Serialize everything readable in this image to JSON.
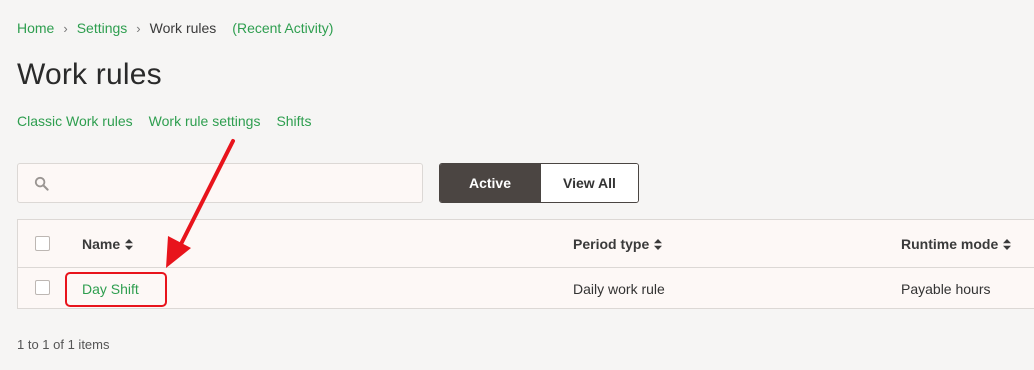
{
  "breadcrumb": {
    "home": "Home",
    "settings": "Settings",
    "current": "Work rules",
    "recent_activity": "(Recent Activity)",
    "separator": "›"
  },
  "page_title": "Work rules",
  "subnav": {
    "classic": "Classic Work rules",
    "settings": "Work rule settings",
    "shifts": "Shifts"
  },
  "search": {
    "value": "",
    "placeholder": ""
  },
  "filter_toggle": {
    "active_label": "Active",
    "view_all_label": "View All",
    "selected": "Active"
  },
  "table": {
    "columns": {
      "name": "Name",
      "period_type": "Period type",
      "runtime_mode": "Runtime mode"
    },
    "rows": [
      {
        "name": "Day Shift",
        "period_type": "Daily work rule",
        "runtime_mode": "Payable hours"
      }
    ]
  },
  "pager": {
    "summary": "1 to 1 of 1 items"
  },
  "colors": {
    "link_green": "#2e9e4f",
    "toggle_active_bg": "#4b4542",
    "annotation_red": "#e8141c",
    "page_bg": "#f6f5f4"
  }
}
